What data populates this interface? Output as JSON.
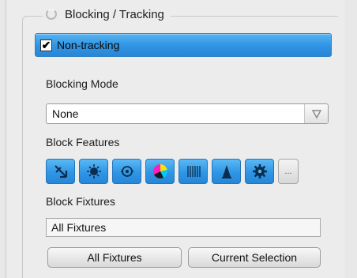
{
  "group": {
    "title": "Blocking / Tracking"
  },
  "non_tracking": {
    "label": "Non-tracking",
    "checked": true,
    "check_glyph": "✔"
  },
  "blocking_mode": {
    "label": "Blocking Mode",
    "value": "None"
  },
  "block_features": {
    "label": "Block Features",
    "buttons": [
      {
        "icon": "position-arrow-icon"
      },
      {
        "icon": "gobo-icon"
      },
      {
        "icon": "beam-icon"
      },
      {
        "icon": "color-wheel-icon"
      },
      {
        "icon": "prism-icon"
      },
      {
        "icon": "focus-cone-icon"
      },
      {
        "icon": "gear-icon"
      }
    ],
    "more_label": "..."
  },
  "block_fixtures": {
    "label": "Block Fixtures",
    "value": "All Fixtures"
  },
  "buttons": {
    "all_fixtures": "All Fixtures",
    "current_selection": "Current Selection"
  },
  "colors": {
    "accent": "#2e93e3"
  }
}
